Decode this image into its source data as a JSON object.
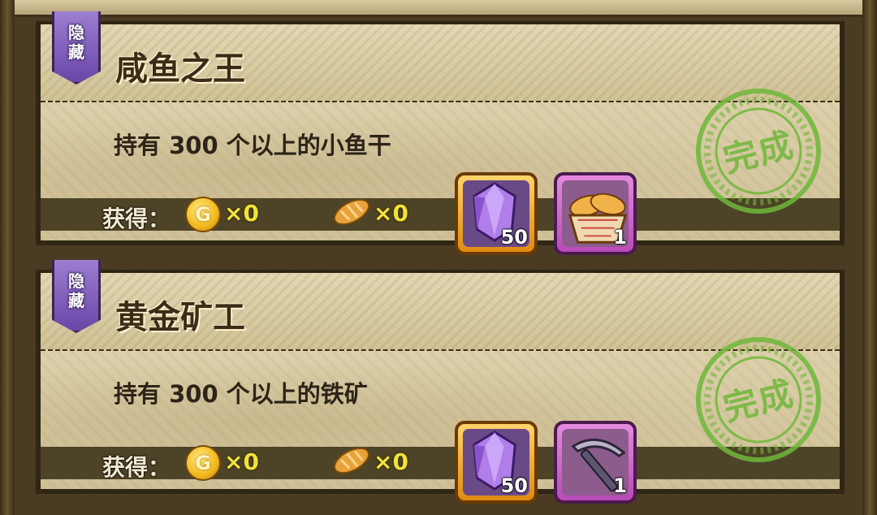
{
  "missions": [
    {
      "tag_chars": [
        "隐",
        "藏"
      ],
      "title": "咸鱼之王",
      "description": "持有 300 个以上的小鱼干",
      "reward_label": "获得：",
      "coin_symbol": "G",
      "coin_count": "×0",
      "bread_count": "×0",
      "items": [
        {
          "icon": "purple-gem-icon",
          "qty": "50",
          "frame": "gold"
        },
        {
          "icon": "bread-basket-icon",
          "qty": "1",
          "frame": "purple"
        }
      ],
      "stamp_text": "完成",
      "stamp_ring": "Mission Complete"
    },
    {
      "tag_chars": [
        "隐",
        "藏"
      ],
      "title": "黄金矿工",
      "description": "持有 300 个以上的铁矿",
      "reward_label": "获得：",
      "coin_symbol": "G",
      "coin_count": "×0",
      "bread_count": "×0",
      "items": [
        {
          "icon": "purple-gem-icon",
          "qty": "50",
          "frame": "gold"
        },
        {
          "icon": "pickaxe-icon",
          "qty": "1",
          "frame": "purple"
        }
      ],
      "stamp_text": "完成",
      "stamp_ring": "Mission Complete"
    }
  ],
  "colors": {
    "tag_purple": "#7b56b8",
    "count_yellow": "#f3e23a",
    "stamp_green": "#6fb83a",
    "slot_gold": "#f0a020",
    "slot_purple": "#c35cc3"
  }
}
